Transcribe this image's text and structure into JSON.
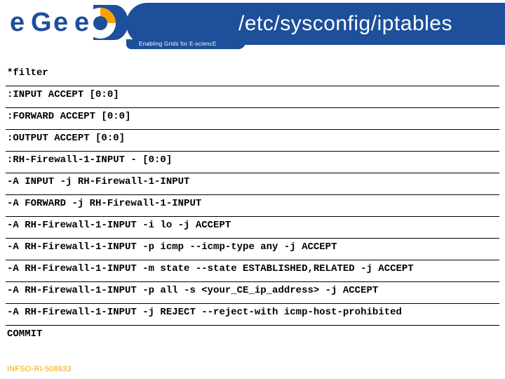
{
  "header": {
    "title": "/etc/sysconfig/iptables",
    "subtitle": "Enabling Grids for E-sciencE"
  },
  "content": {
    "lines": [
      "*filter",
      ":INPUT ACCEPT [0:0]",
      ":FORWARD ACCEPT [0:0]",
      ":OUTPUT ACCEPT [0:0]",
      ":RH-Firewall-1-INPUT - [0:0]",
      "-A INPUT -j RH-Firewall-1-INPUT",
      "-A FORWARD -j RH-Firewall-1-INPUT",
      "-A RH-Firewall-1-INPUT -i lo -j ACCEPT",
      "-A RH-Firewall-1-INPUT -p icmp --icmp-type any -j ACCEPT",
      "-A RH-Firewall-1-INPUT -m state --state ESTABLISHED,RELATED -j ACCEPT",
      "-A RH-Firewall-1-INPUT -p all -s <your_CE_ip_address> -j ACCEPT",
      "-A RH-Firewall-1-INPUT -j REJECT --reject-with icmp-host-prohibited",
      "COMMIT"
    ]
  },
  "footer": {
    "ref": "INFSO-RI-508833"
  }
}
